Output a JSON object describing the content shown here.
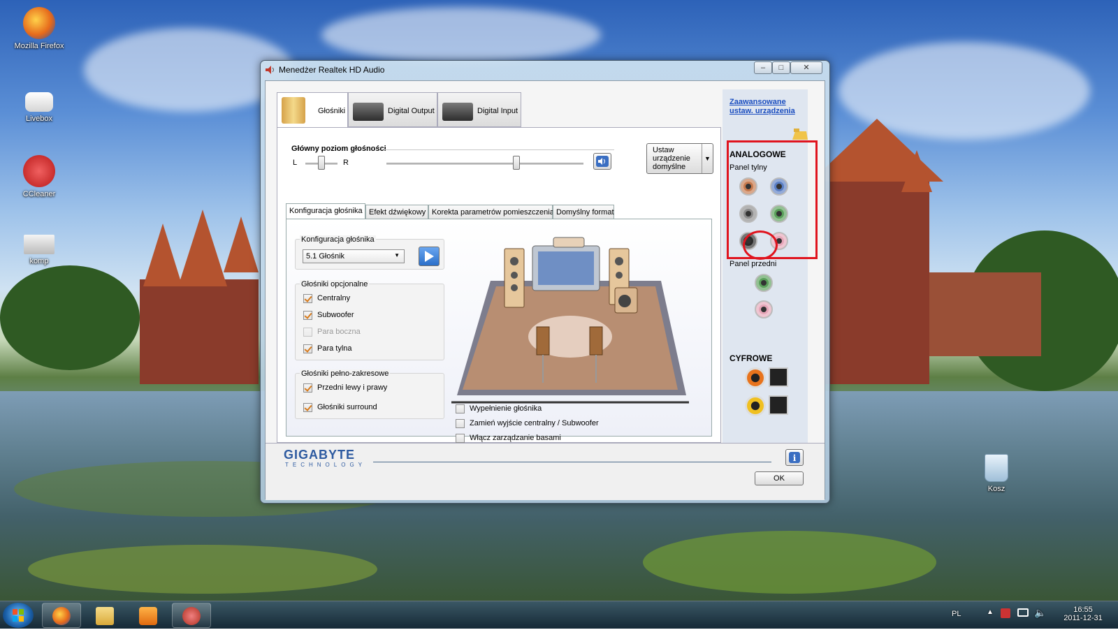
{
  "desktop": {
    "icons": [
      {
        "label": "Mozilla Firefox",
        "icon": "firefox-icon",
        "color": "#e66a1b"
      },
      {
        "label": "Livebox",
        "icon": "livebox-icon",
        "color": "#f2f2f2"
      },
      {
        "label": "CCleaner",
        "icon": "ccleaner-icon",
        "color": "#d62b2b"
      },
      {
        "label": "komp",
        "icon": "computer-icon",
        "color": "#ddd"
      },
      {
        "label": "Kosz",
        "icon": "recycle-bin-icon",
        "color": "#cfe3f2"
      }
    ]
  },
  "window": {
    "title": "Menedżer Realtek HD Audio",
    "tabs": [
      {
        "label": "Głośniki",
        "icon": "speakers-icon"
      },
      {
        "label": "Digital Output",
        "icon": "digital-output-icon"
      },
      {
        "label": "Digital Input",
        "icon": "digital-input-icon"
      }
    ],
    "volume": {
      "label": "Główny poziom głośności",
      "left": "L",
      "right": "R",
      "level": 0.66,
      "balance": 0.5
    },
    "default_device": {
      "label": "Ustaw urządzenie domyślne"
    },
    "subtabs": [
      "Konfiguracja głośnika",
      "Efekt dźwiękowy",
      "Korekta parametrów pomieszczenia",
      "Domyślny format"
    ],
    "config": {
      "group_label": "Konfiguracja głośnika",
      "selected": "5.1 Głośnik"
    },
    "optional": {
      "label": "Głośniki opcjonalne",
      "items": [
        {
          "label": "Centralny",
          "checked": true,
          "enabled": true
        },
        {
          "label": "Subwoofer",
          "checked": true,
          "enabled": true
        },
        {
          "label": "Para boczna",
          "checked": false,
          "enabled": false
        },
        {
          "label": "Para tylna",
          "checked": true,
          "enabled": true
        }
      ]
    },
    "fullrange": {
      "label": "Głośniki pełno-zakresowe",
      "items": [
        {
          "label": "Przedni lewy i prawy",
          "checked": true
        },
        {
          "label": "Głośniki surround",
          "checked": true
        }
      ]
    },
    "options": [
      {
        "label": "Wypełnienie głośnika",
        "checked": false
      },
      {
        "label": "Zamień wyjście centralny / Subwoofer",
        "checked": false
      },
      {
        "label": "Włącz zarządzanie basami",
        "checked": false
      }
    ],
    "advanced_link": "Zaawansowane ustaw. urządzenia",
    "analog": {
      "title": "ANALOGOWE",
      "rear_label": "Panel tylny",
      "front_label": "Panel przedni",
      "rear_jacks": [
        "#c77a4e",
        "#5b7fc4",
        "#8a8a8a",
        "#5aa05a",
        "#2b2b2b",
        "#e6a6b8"
      ],
      "front_jacks": [
        "#5aa05a",
        "#e6a6b8"
      ]
    },
    "digital": {
      "title": "CYFROWE"
    },
    "brand": {
      "name": "GIGABYTE",
      "sub": "TECHNOLOGY"
    },
    "ok_label": "OK"
  },
  "taskbar": {
    "lang": "PL",
    "time": "16:55",
    "date": "2011-12-31"
  },
  "colors": {
    "annotation": "#e0141e",
    "accent": "#2a6fc9"
  }
}
